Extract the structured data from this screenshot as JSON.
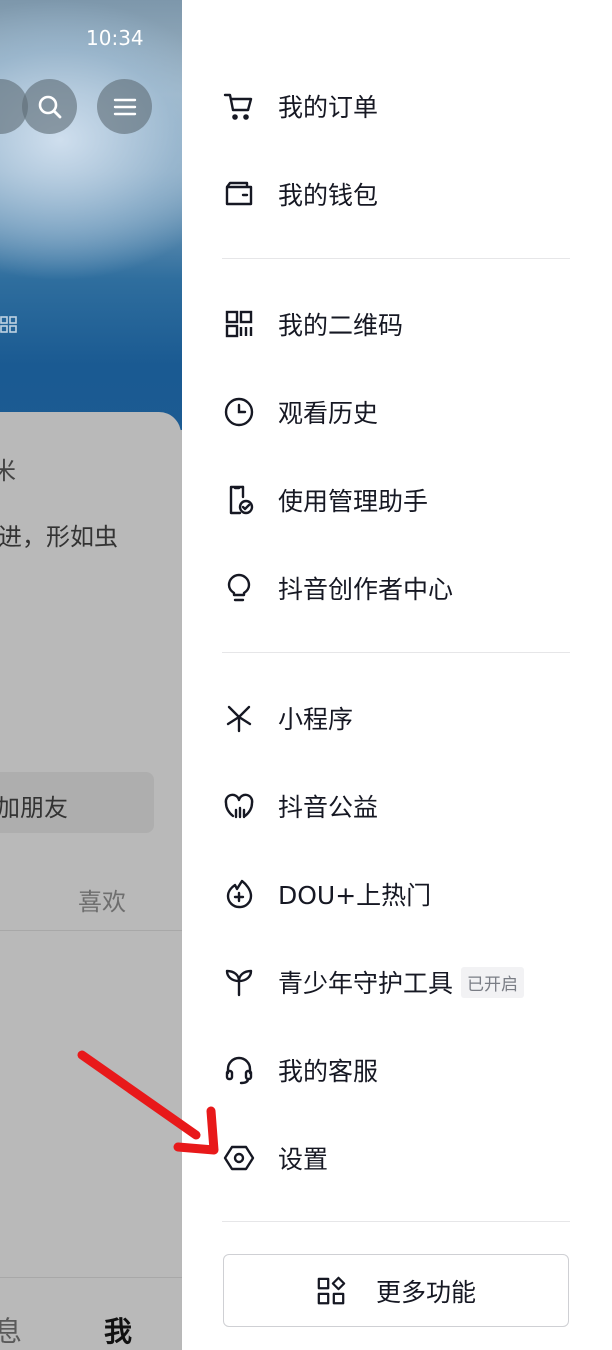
{
  "status_bar": {
    "time": "10:34"
  },
  "left_background": {
    "partial_title": "米",
    "partial_bio": "进，形如虫",
    "add_friend_button": "加朋友",
    "likes_tab": "喜欢",
    "bottom_nav": {
      "messages": "息",
      "me": "我"
    }
  },
  "drawer": {
    "section1": [
      {
        "label": "我的订单",
        "icon": "cart-icon"
      },
      {
        "label": "我的钱包",
        "icon": "wallet-icon"
      }
    ],
    "section2": [
      {
        "label": "我的二维码",
        "icon": "qr-code-icon"
      },
      {
        "label": "观看历史",
        "icon": "clock-icon"
      },
      {
        "label": "使用管理助手",
        "icon": "phone-check-icon"
      },
      {
        "label": "抖音创作者中心",
        "icon": "lightbulb-icon"
      }
    ],
    "section3": [
      {
        "label": "小程序",
        "icon": "mini-program-icon"
      },
      {
        "label": "抖音公益",
        "icon": "heart-charity-icon"
      },
      {
        "label": "DOU+上热门",
        "icon": "fire-plus-icon"
      },
      {
        "label": "青少年守护工具",
        "icon": "sprout-icon",
        "badge": "已开启"
      },
      {
        "label": "我的客服",
        "icon": "headset-icon"
      },
      {
        "label": "设置",
        "icon": "settings-hexagon-icon"
      }
    ],
    "more_button": {
      "label": "更多功能",
      "icon": "grid-more-icon"
    }
  },
  "annotation": {
    "type": "red-arrow",
    "color": "#e8191a",
    "points_to": "settings"
  }
}
